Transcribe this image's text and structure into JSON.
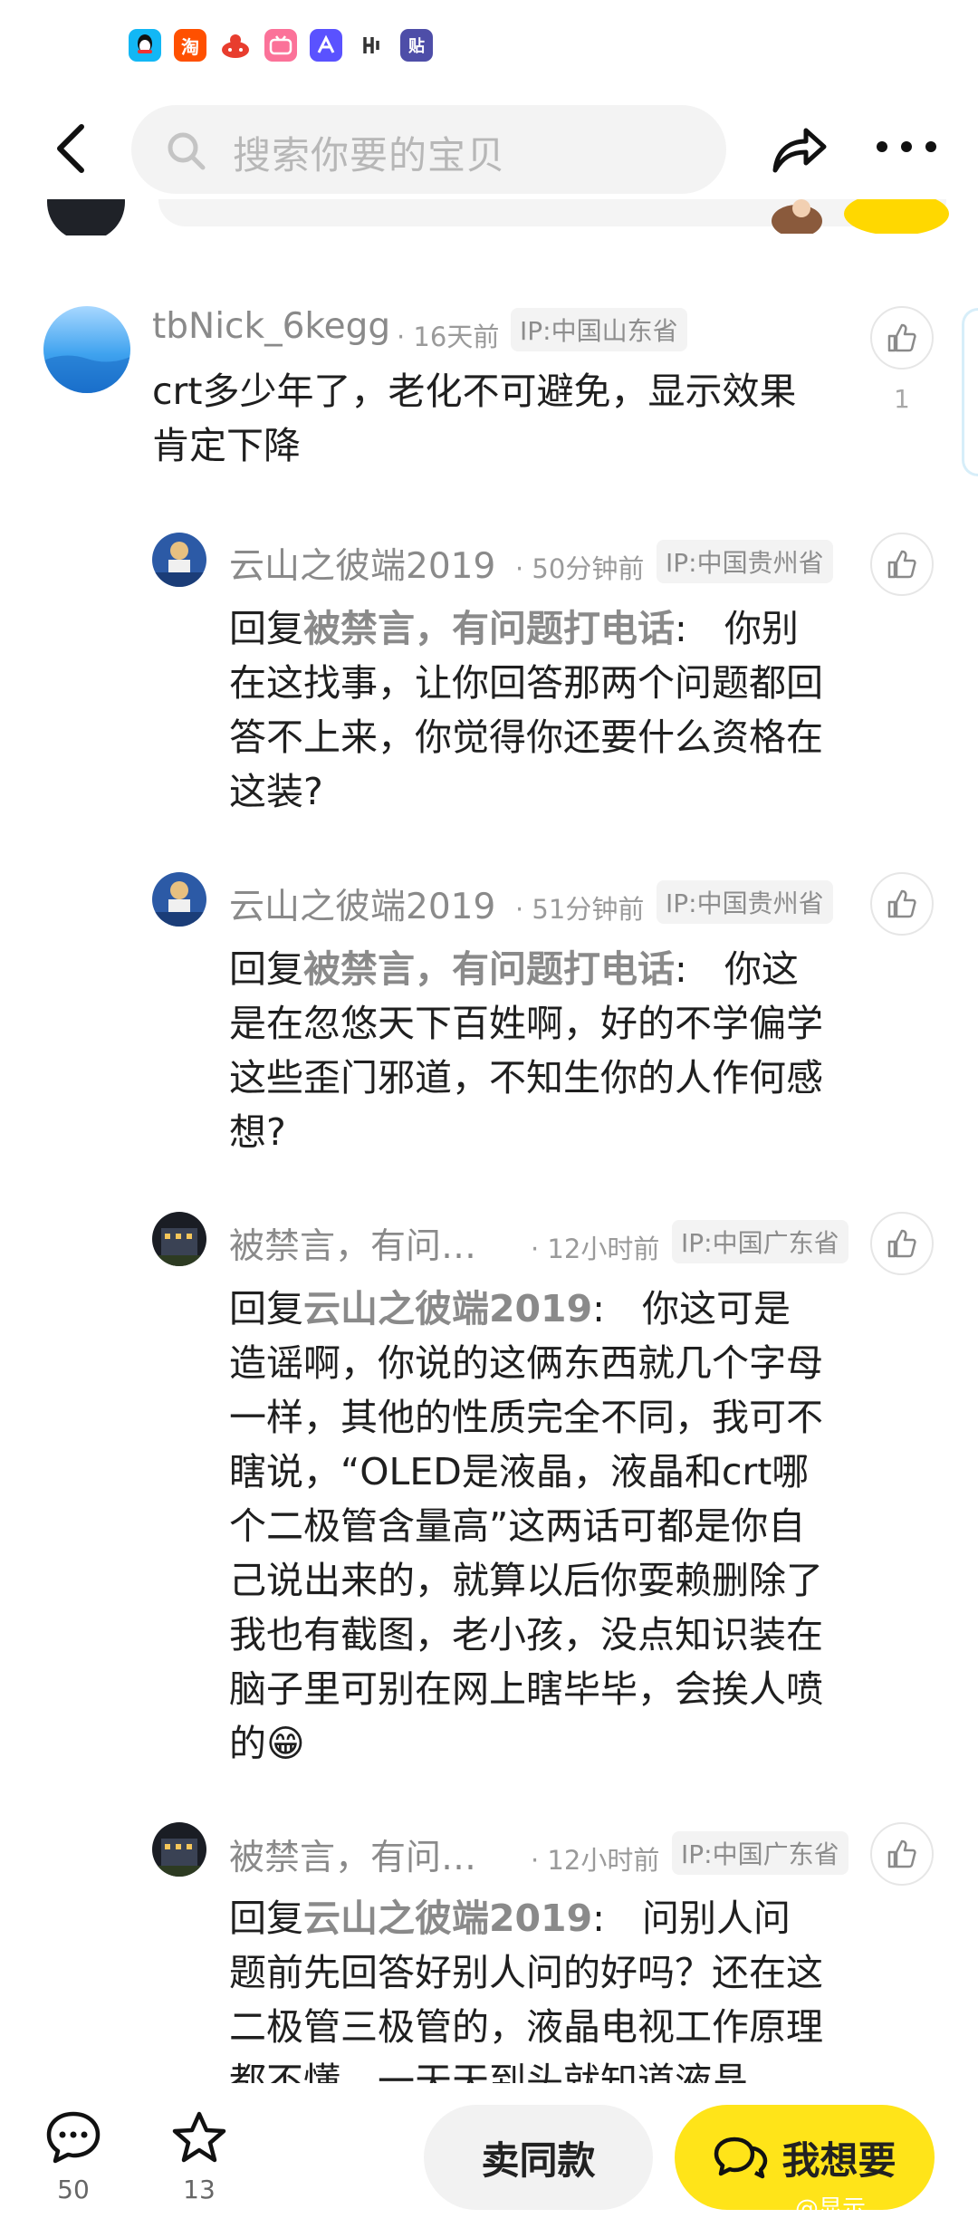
{
  "search": {
    "placeholder": "搜索你要的宝贝"
  },
  "status_icons": [
    {
      "name": "qq-icon",
      "color": "#12b7f5"
    },
    {
      "name": "taobao-icon",
      "color": "#ff5000",
      "glyph": "淘"
    },
    {
      "name": "game-icon",
      "color": "#e83d2e"
    },
    {
      "name": "bilibili-icon",
      "color": "#fb7299"
    },
    {
      "name": "alibaba-icon",
      "color": "#5a52ff"
    },
    {
      "name": "app-icon",
      "color": "#333333"
    },
    {
      "name": "tieba-icon",
      "color": "#4e4ea8",
      "glyph": "贴"
    }
  ],
  "comments": [
    {
      "username": "tbNick_6kegg",
      "time": "· 16天前",
      "ip": "IP:中国山东省",
      "likes": "1",
      "text": "crt多少年了，老化不可避免，显示效果肯定下降"
    },
    {
      "username": "云山之彼端2019",
      "time": "· 50分钟前",
      "ip": "IP:中国贵州省",
      "reply_prefix": "回复",
      "reply_target": "被禁言，有问题打电话",
      "text": ":　你别在这找事，让你回答那两个问题都回答不上来，你觉得你还要什么资格在这装?"
    },
    {
      "username": "云山之彼端2019",
      "time": "· 51分钟前",
      "ip": "IP:中国贵州省",
      "reply_prefix": "回复",
      "reply_target": "被禁言，有问题打电话",
      "text": ":　你这是在忽悠天下百姓啊，好的不学偏学这些歪门邪道，不知生你的人作何感想?"
    },
    {
      "username": "被禁言，有问…",
      "time": "· 12小时前",
      "ip": "IP:中国广东省",
      "reply_prefix": "回复",
      "reply_target": "云山之彼端2019",
      "text": ":　你这可是造谣啊，你说的这俩东西就几个字母一样，其他的性质完全不同，我可不瞎说，“OLED是液晶，液晶和crt哪个二极管含量高”这两话可都是你自己说出来的，就算以后你耍赖删除了我也有截图，老小孩，没点知识装在脑子里可别在网上瞎毕毕，会挨人喷的😁"
    },
    {
      "username": "被禁言，有问…",
      "time": "· 12小时前",
      "ip": "IP:中国广东省",
      "reply_prefix": "回复",
      "reply_target": "云山之彼端2019",
      "text": ":　问别人问题前先回答好别人问的好吗？还在这二极管三极管的，液晶电视工作原理都不懂，一天天到头就知道液晶"
    }
  ],
  "bottom": {
    "comment_count": "50",
    "favorite_count": "13",
    "same_label": "卖同款",
    "want_label": "我想要",
    "watermark": "@显示"
  }
}
